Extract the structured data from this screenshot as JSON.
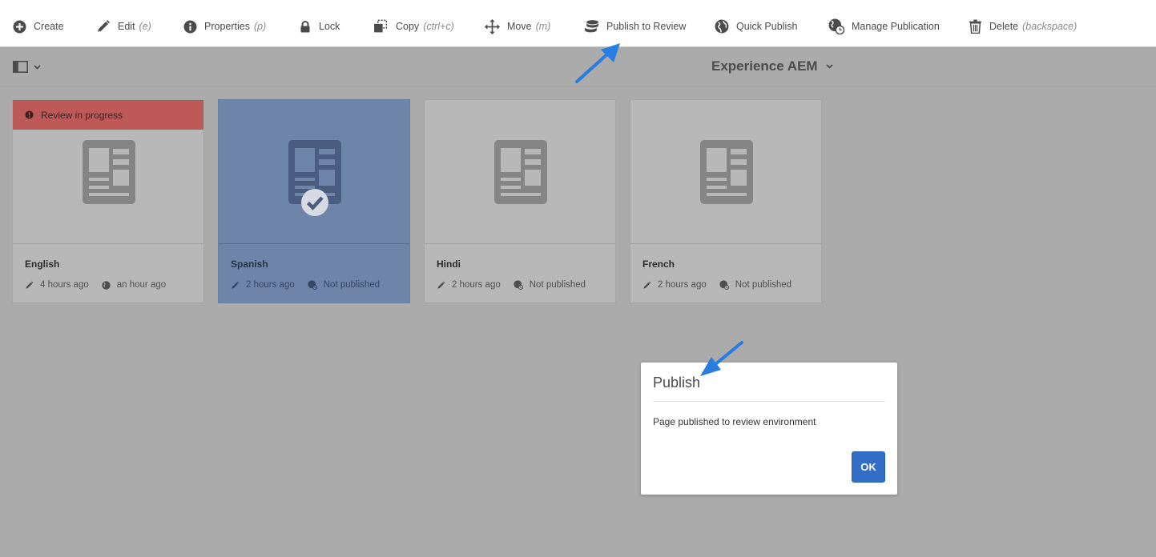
{
  "toolbar": {
    "create": "Create",
    "edit": "Edit",
    "edit_shortcut": "(e)",
    "properties": "Properties",
    "properties_shortcut": "(p)",
    "lock": "Lock",
    "copy": "Copy",
    "copy_shortcut": "(ctrl+c)",
    "move": "Move",
    "move_shortcut": "(m)",
    "publish_review": "Publish to Review",
    "quick_publish": "Quick Publish",
    "manage_publication": "Manage Publication",
    "delete": "Delete",
    "delete_shortcut": "(backspace)"
  },
  "header": {
    "title": "Experience AEM"
  },
  "cards": [
    {
      "name": "English",
      "modified": "4 hours ago",
      "published": "an hour ago",
      "banner": "Review in progress",
      "selected": false
    },
    {
      "name": "Spanish",
      "modified": "2 hours ago",
      "published": "Not published",
      "selected": true
    },
    {
      "name": "Hindi",
      "modified": "2 hours ago",
      "published": "Not published",
      "selected": false
    },
    {
      "name": "French",
      "modified": "2 hours ago",
      "published": "Not published",
      "selected": false
    }
  ],
  "dialog": {
    "title": "Publish",
    "message": "Page published to review environment",
    "ok_label": "OK"
  },
  "colors": {
    "accent": "#326ec8",
    "banner": "#bd5a58",
    "selected_card": "#6e84a8",
    "overlay_bg": "#ababab"
  }
}
